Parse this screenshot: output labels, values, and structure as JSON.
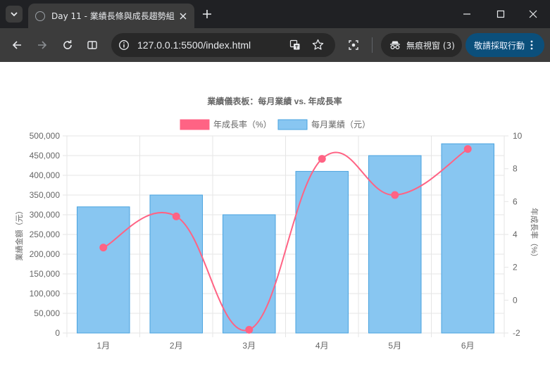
{
  "browser": {
    "tab_title": "Day 11 - 業績長條與成長趨勢組",
    "url": "127.0.0.1:5500/index.html",
    "incognito_label": "無痕視窗 (3)",
    "action_label": "敬請採取行動"
  },
  "chart_data": {
    "type": "bar",
    "title": "業績儀表板：每月業績 vs. 年成長率",
    "categories": [
      "1月",
      "2月",
      "3月",
      "4月",
      "5月",
      "6月"
    ],
    "series": [
      {
        "name": "每月業績（元）",
        "type": "bar",
        "axis": "left",
        "color": "#88c6f1",
        "border": "#4aa3df",
        "values": [
          320000,
          350000,
          300000,
          410000,
          450000,
          480000
        ]
      },
      {
        "name": "年成長率（%）",
        "type": "line",
        "axis": "right",
        "color": "#ff6384",
        "values": [
          3.2,
          5.1,
          -1.8,
          8.6,
          6.4,
          9.2
        ]
      }
    ],
    "legend_order": [
      "年成長率（%）",
      "每月業績（元）"
    ],
    "legend_position": "top",
    "ylabel": "業績金額（元）",
    "y2label": "年成長率（%）",
    "ylim": [
      0,
      500000
    ],
    "y2lim": [
      -2,
      10
    ],
    "y_ticks": [
      "0",
      "50,000",
      "100,000",
      "150,000",
      "200,000",
      "250,000",
      "300,000",
      "350,000",
      "400,000",
      "450,000",
      "500,000"
    ],
    "y2_ticks": [
      "-2",
      "0",
      "2",
      "4",
      "6",
      "8",
      "10"
    ],
    "grid": true
  }
}
